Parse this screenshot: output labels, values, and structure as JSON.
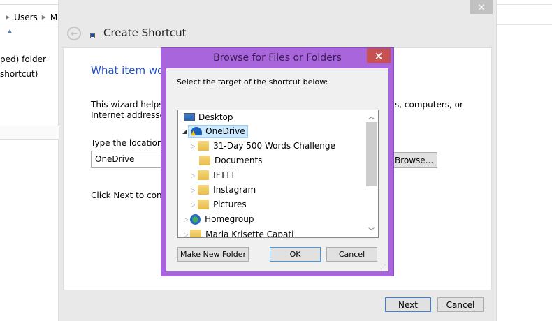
{
  "explorer": {
    "breadcrumb": [
      "Users",
      "M"
    ],
    "items": [
      "ped) folder",
      "shortcut)"
    ]
  },
  "wizard": {
    "title": "Create Shortcut",
    "heading": "What item wou",
    "intro_line1": "This wizard helps y",
    "intro_line1_end": "s, computers, or",
    "intro_line2": "Internet addresses.",
    "location_label": "Type the location o",
    "location_value": "OneDrive",
    "browse_label": "Browse...",
    "next_hint": "Click Next to contin",
    "next_label": "Next",
    "cancel_label": "Cancel",
    "close_label": "×"
  },
  "browse": {
    "title": "Browse for Files or Folders",
    "close_label": "×",
    "instruction": "Select the target of the shortcut below:",
    "tree": [
      {
        "label": "Desktop"
      },
      {
        "label": "OneDrive"
      },
      {
        "label": "31-Day 500 Words Challenge"
      },
      {
        "label": "Documents"
      },
      {
        "label": "IFTTT"
      },
      {
        "label": "Instagram"
      },
      {
        "label": "Pictures"
      },
      {
        "label": "Homegroup"
      },
      {
        "label": "Maria Krisette Capati"
      }
    ],
    "make_folder_label": "Make New Folder",
    "ok_label": "OK",
    "cancel_label": "Cancel"
  },
  "colors": {
    "accent": "#a865dc",
    "close_red": "#c75050",
    "link_blue": "#1e4fc4"
  }
}
